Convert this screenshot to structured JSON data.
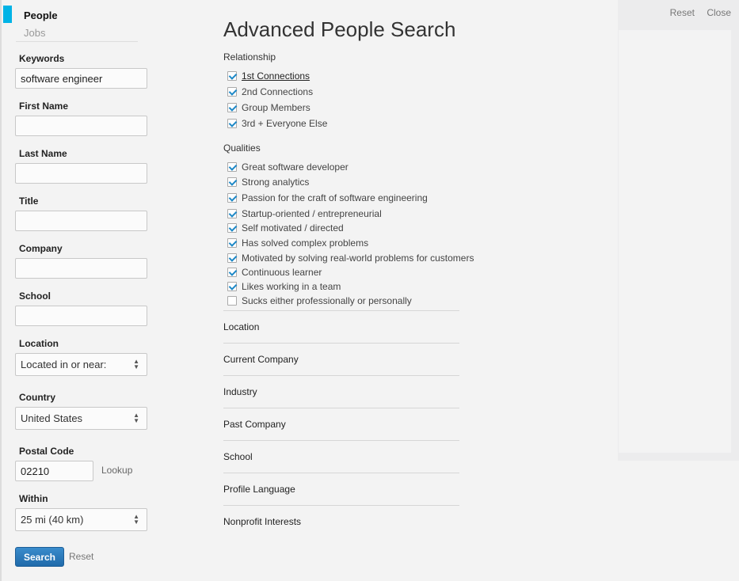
{
  "top_actions": {
    "reset": "Reset",
    "close": "Close"
  },
  "nav": {
    "items": [
      {
        "label": "People",
        "active": true
      },
      {
        "label": "Jobs",
        "active": false
      }
    ]
  },
  "form": {
    "keywords": {
      "label": "Keywords",
      "value": "software engineer"
    },
    "first_name": {
      "label": "First Name",
      "value": ""
    },
    "last_name": {
      "label": "Last Name",
      "value": ""
    },
    "title": {
      "label": "Title",
      "value": ""
    },
    "company": {
      "label": "Company",
      "value": ""
    },
    "school": {
      "label": "School",
      "value": ""
    },
    "location": {
      "label": "Location",
      "selected": "Located in or near:"
    },
    "country": {
      "label": "Country",
      "selected": "United States"
    },
    "postal_code": {
      "label": "Postal Code",
      "value": "02210",
      "lookup": "Lookup"
    },
    "within": {
      "label": "Within",
      "selected": "25 mi (40 km)"
    },
    "search_label": "Search",
    "reset_label": "Reset"
  },
  "advanced": {
    "title": "Advanced People Search",
    "relationship": {
      "label": "Relationship",
      "options": [
        {
          "label": "1st Connections",
          "checked": true
        },
        {
          "label": "2nd Connections",
          "checked": true
        },
        {
          "label": "Group Members",
          "checked": true
        },
        {
          "label": "3rd + Everyone Else",
          "checked": true
        }
      ]
    },
    "qualities": {
      "label": "Qualities",
      "options": [
        {
          "label": "Great software developer",
          "checked": true
        },
        {
          "label": "Strong analytics",
          "checked": true
        },
        {
          "label": "Passion for the craft of software engineering",
          "checked": true
        },
        {
          "label": "Startup-oriented / entrepreneurial",
          "checked": true
        },
        {
          "label": "Self motivated / directed",
          "checked": true
        },
        {
          "label": "Has solved complex problems",
          "checked": true
        },
        {
          "label": "Motivated by solving real-world problems for customers",
          "checked": true
        },
        {
          "label": "Continuous learner",
          "checked": true
        },
        {
          "label": "Likes working in a team",
          "checked": true
        },
        {
          "label": "Sucks either professionally or personally",
          "checked": false
        }
      ]
    },
    "facets": [
      "Location",
      "Current Company",
      "Industry",
      "Past Company",
      "School",
      "Profile Language",
      "Nonprofit Interests"
    ]
  },
  "colors": {
    "accent": "#00b3e6",
    "button": "#2a7bbd",
    "check": "#1d88c7"
  }
}
